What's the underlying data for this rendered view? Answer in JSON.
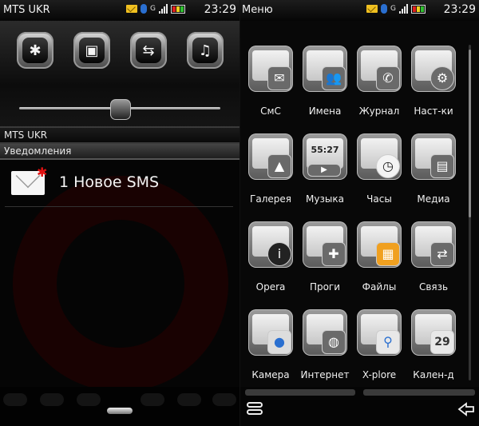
{
  "left_screen": {
    "status": {
      "operator": "MTS UKR",
      "time": "23:29",
      "network_type": "G"
    },
    "toggles": [
      {
        "name": "bluetooth",
        "icon": "bluetooth-icon",
        "glyph": "✱"
      },
      {
        "name": "profiles",
        "icon": "profiles-icon",
        "glyph": "▣"
      },
      {
        "name": "data-transfer",
        "icon": "data-transfer-icon",
        "glyph": "⇆"
      },
      {
        "name": "music",
        "icon": "music-icon",
        "glyph": "♫"
      }
    ],
    "volume_level": 0.5,
    "operator_row": "MTS UKR",
    "notifications_header": "Уведомления",
    "notification": {
      "text": "1 Новое SMS",
      "icon": "sms-envelope-icon"
    }
  },
  "right_screen": {
    "status": {
      "title": "Меню",
      "time": "23:29",
      "network_type": "G"
    },
    "apps": [
      {
        "label": "СмС",
        "icon": "messages-icon",
        "glyph": "✉"
      },
      {
        "label": "Имена",
        "icon": "contacts-icon",
        "glyph": "👥"
      },
      {
        "label": "Журнал",
        "icon": "log-icon",
        "glyph": "✆"
      },
      {
        "label": "Наст-ки",
        "icon": "settings-gear-icon",
        "glyph": "⚙"
      },
      {
        "label": "Галерея",
        "icon": "gallery-icon",
        "glyph": "▲"
      },
      {
        "label": "Музыка",
        "icon": "music-player-icon",
        "glyph": "▶",
        "display_text": "55:27"
      },
      {
        "label": "Часы",
        "icon": "clock-icon",
        "glyph": "◷"
      },
      {
        "label": "Медиа",
        "icon": "media-icon",
        "glyph": "▤"
      },
      {
        "label": "Opera",
        "icon": "opera-browser-icon",
        "glyph": "i"
      },
      {
        "label": "Проги",
        "icon": "programs-puzzle-icon",
        "glyph": "✚"
      },
      {
        "label": "Файлы",
        "icon": "files-icon",
        "glyph": "▦"
      },
      {
        "label": "Связь",
        "icon": "connectivity-icon",
        "glyph": "⇄"
      },
      {
        "label": "Камера",
        "icon": "camera-icon",
        "glyph": "●"
      },
      {
        "label": "Интернет",
        "icon": "internet-globe-icon",
        "glyph": "◍"
      },
      {
        "label": "X-plore",
        "icon": "xplore-search-icon",
        "glyph": "⚲"
      },
      {
        "label": "Кален-д",
        "icon": "calendar-icon",
        "glyph": "29"
      }
    ]
  },
  "colors": {
    "accent_red": "#e01010",
    "battery_red": "#e02020",
    "battery_yellow": "#f0d020",
    "battery_green": "#30c030",
    "bluetooth_blue": "#2a6fd0"
  }
}
